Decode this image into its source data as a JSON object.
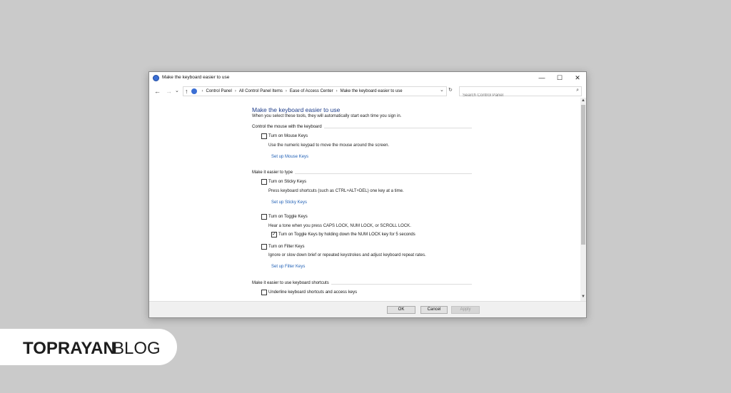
{
  "window": {
    "title": "Make the keyboard easier to use",
    "controls": {
      "minimize": "—",
      "maximize": "☐",
      "close": "✕"
    }
  },
  "addressbar": {
    "back": "←",
    "forward": "→",
    "recent": "⌄",
    "up": "↑",
    "breadcrumbs": [
      "Control Panel",
      "All Control Panel Items",
      "Ease of Access Center",
      "Make the keyboard easier to use"
    ],
    "separator": "›",
    "dropdown": "⌄",
    "refresh": "↻",
    "search_placeholder": "Search Control Panel",
    "search_icon": "⌕"
  },
  "page": {
    "title": "Make the keyboard easier to use",
    "subtitle": "When you select these tools, they will automatically start each time you sign in.",
    "mouse_section": "Control the mouse with the keyboard",
    "mouse_keys_label": "Turn on Mouse Keys",
    "mouse_keys_checked": false,
    "mouse_keys_desc": "Use the numeric keypad to move the mouse around the screen.",
    "mouse_keys_link": "Set up Mouse Keys",
    "type_section": "Make it easier to type",
    "sticky_keys_label": "Turn on Sticky Keys",
    "sticky_keys_checked": false,
    "sticky_keys_desc": "Press keyboard shortcuts (such as CTRL+ALT+DEL) one key at a time.",
    "sticky_keys_link": "Set up Sticky Keys",
    "toggle_keys_label": "Turn on Toggle Keys",
    "toggle_keys_checked": false,
    "toggle_keys_desc": "Hear a tone when you press CAPS LOCK, NUM LOCK, or SCROLL LOCK.",
    "toggle_hold_label": "Turn on Toggle Keys by holding down the NUM LOCK key for 5 seconds",
    "toggle_hold_checked": true,
    "filter_keys_label": "Turn on Filter Keys",
    "filter_keys_checked": false,
    "filter_keys_desc": "Ignore or slow down brief or repeated keystrokes and adjust keyboard repeat rates.",
    "filter_keys_link": "Set up Filter Keys",
    "shortcuts_section": "Make it easier to use keyboard shortcuts",
    "underline_label": "Underline keyboard shortcuts and access keys",
    "underline_checked": false,
    "check_mark": "✓"
  },
  "scrollbar": {
    "up": "▲",
    "down": "▼"
  },
  "footer": {
    "ok": "OK",
    "cancel": "Cancel",
    "apply": "Apply"
  },
  "brand": {
    "bold": "TOPRAYAN",
    "light": "BLOG"
  },
  "colors": {
    "background": "#cacaca",
    "link": "#1f5fb5",
    "heading": "#1e3d8a"
  }
}
